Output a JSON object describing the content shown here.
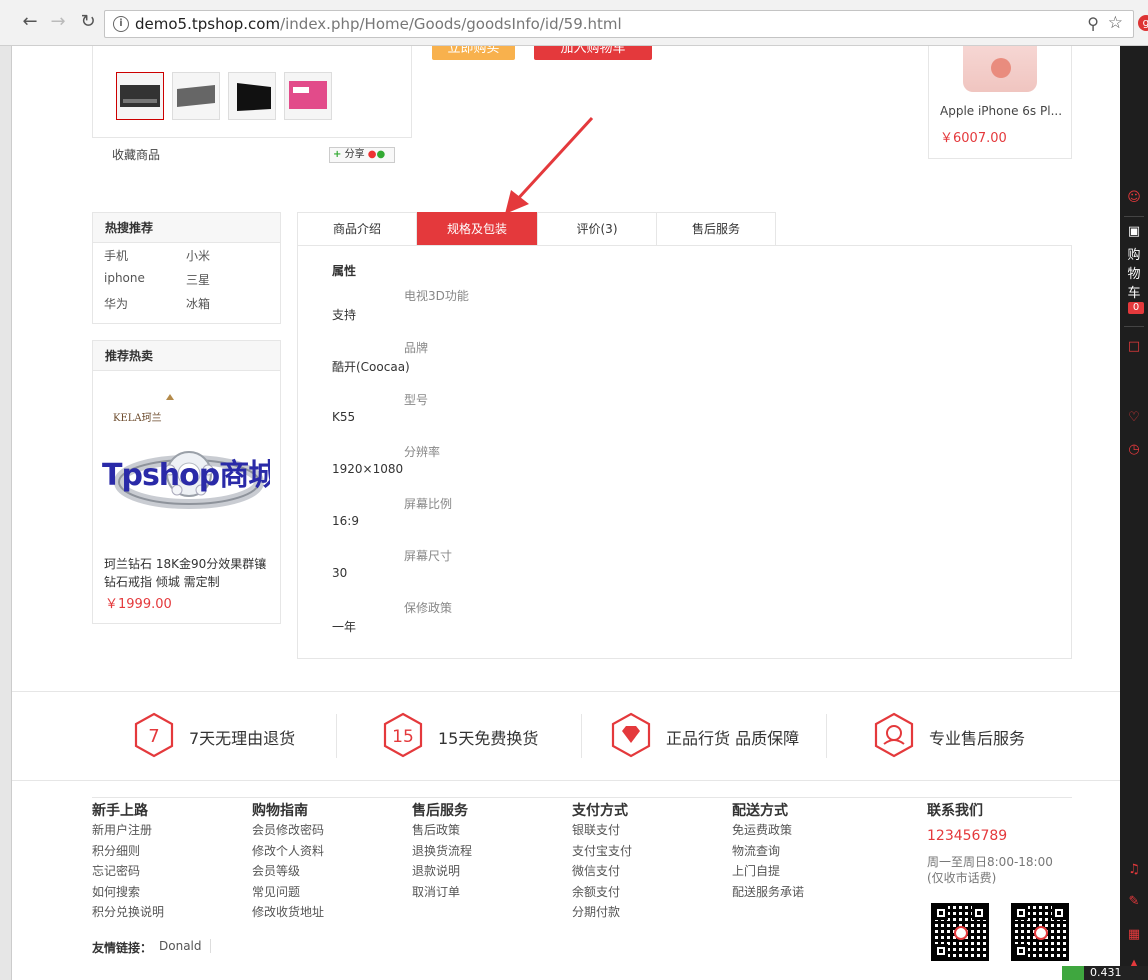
{
  "browser": {
    "url_host": "demo5.tpshop.com",
    "url_path": "/index.php/Home/Goods/goodsInfo/id/59.html"
  },
  "product": {
    "buy_now_label": "立即购买",
    "add_cart_label": "加入购物车",
    "favorite_label": "收藏商品",
    "share_label": "分享"
  },
  "related": {
    "name": "Apple iPhone 6s Pl...",
    "price": "￥6007.00"
  },
  "hot_search": {
    "title": "热搜推荐",
    "keywords": [
      "手机",
      "小米",
      "iphone",
      "三星",
      "华为",
      "冰箱"
    ]
  },
  "hot_sale": {
    "title": "推荐热卖",
    "brand": "KELA珂兰",
    "watermark": "Tpshop商城",
    "name_line1": "珂兰钻石 18K金90分效果群镶",
    "name_line2": "钻石戒指 倾城 需定制",
    "price": "￥1999.00"
  },
  "tabs": [
    {
      "label": "商品介绍",
      "active": false
    },
    {
      "label": "规格及包装",
      "active": true
    },
    {
      "label": "评价(3)",
      "active": false
    },
    {
      "label": "售后服务",
      "active": false
    }
  ],
  "specs": {
    "heading": "属性",
    "rows": [
      {
        "name": "电视3D功能",
        "value": "支持"
      },
      {
        "name": "品牌",
        "value": "酷开(Coocaa)"
      },
      {
        "name": "型号",
        "value": "K55"
      },
      {
        "name": "分辨率",
        "value": "1920×1080"
      },
      {
        "name": "屏幕比例",
        "value": "16:9"
      },
      {
        "name": "屏幕尺寸",
        "value": "30"
      },
      {
        "name": "保修政策",
        "value": "一年"
      }
    ]
  },
  "services": [
    {
      "badge": "7",
      "text": "7天无理由退货"
    },
    {
      "badge": "15",
      "text": "15天免费换货"
    },
    {
      "badge": "",
      "text": "正品行货 品质保障"
    },
    {
      "badge": "",
      "text": "专业售后服务"
    }
  ],
  "footer": {
    "columns": [
      {
        "title": "新手上路",
        "links": [
          "新用户注册",
          "积分细则",
          "忘记密码",
          "如何搜索",
          "积分兑换说明"
        ]
      },
      {
        "title": "购物指南",
        "links": [
          "会员修改密码",
          "修改个人资料",
          "会员等级",
          "常见问题",
          "修改收货地址"
        ]
      },
      {
        "title": "售后服务",
        "links": [
          "售后政策",
          "退换货流程",
          "退款说明",
          "取消订单"
        ]
      },
      {
        "title": "支付方式",
        "links": [
          "银联支付",
          "支付宝支付",
          "微信支付",
          "余额支付",
          "分期付款"
        ]
      },
      {
        "title": "配送方式",
        "links": [
          "免运费政策",
          "物流查询",
          "上门自提",
          "配送服务承诺"
        ]
      }
    ],
    "contact": {
      "title": "联系我们",
      "phone": "123456789",
      "hours": "周一至周日8:00-18:00",
      "note": "(仅收市话费)"
    },
    "friend_links_label": "友情链接：",
    "friend_link": "Donald"
  },
  "toolbar": {
    "cart_label_1": "购",
    "cart_label_2": "物",
    "cart_label_3": "车",
    "cart_count": "0"
  },
  "corner_text": "0.431"
}
